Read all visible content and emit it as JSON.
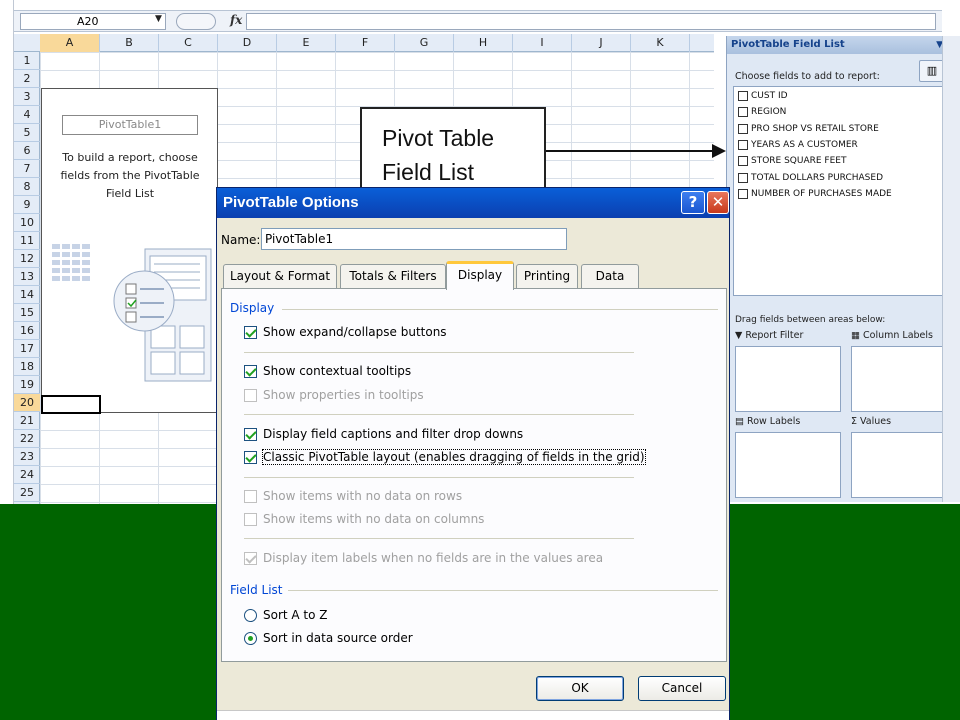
{
  "spreadsheet": {
    "name_box": "A20",
    "fx_label": "fx",
    "columns": [
      {
        "label": "A",
        "active": true
      },
      {
        "label": "B",
        "active": false
      },
      {
        "label": "C",
        "active": false
      },
      {
        "label": "D",
        "active": false
      },
      {
        "label": "E",
        "active": false
      },
      {
        "label": "F",
        "active": false
      },
      {
        "label": "G",
        "active": false
      },
      {
        "label": "H",
        "active": false
      },
      {
        "label": "I",
        "active": false
      },
      {
        "label": "J",
        "active": false
      },
      {
        "label": "K",
        "active": false
      }
    ],
    "rows": [
      "1",
      "2",
      "3",
      "4",
      "5",
      "6",
      "7",
      "8",
      "9",
      "10",
      "11",
      "12",
      "13",
      "14",
      "15",
      "16",
      "17",
      "18",
      "19",
      "20",
      "21",
      "22",
      "23",
      "24",
      "25"
    ],
    "active_row": "20"
  },
  "pivot_placeholder": {
    "name": "PivotTable1",
    "instruction_lines": [
      "To build a report, choose",
      "fields from the PivotTable",
      "Field List"
    ]
  },
  "callout": {
    "lines": [
      "Pivot Table",
      "Field List"
    ]
  },
  "field_list": {
    "title": "PivotTable Field List",
    "choose_label": "Choose fields to add to report:",
    "fields": [
      "CUST ID",
      "REGION",
      "PRO SHOP VS RETAIL STORE",
      "YEARS AS A CUSTOMER",
      "STORE SQUARE FEET",
      "TOTAL DOLLARS PURCHASED",
      "NUMBER OF PURCHASES MADE"
    ],
    "drag_label": "Drag fields between areas below:",
    "areas": {
      "report_filter": "Report Filter",
      "column_labels": "Column Labels",
      "row_labels": "Row Labels",
      "values": "Values"
    }
  },
  "dialog": {
    "title": "PivotTable Options",
    "help": "?",
    "close": "✕",
    "name_label": "Name:",
    "name_value": "PivotTable1",
    "tabs": [
      {
        "label": "Layout & Format",
        "selected": false
      },
      {
        "label": "Totals & Filters",
        "selected": false
      },
      {
        "label": "Display",
        "selected": true
      },
      {
        "label": "Printing",
        "selected": false
      },
      {
        "label": "Data",
        "selected": false
      }
    ],
    "display_section": "Display",
    "options": {
      "expand_collapse": {
        "label": "Show expand/collapse buttons",
        "checked": true,
        "enabled": true
      },
      "contextual_tooltips": {
        "label": "Show contextual tooltips",
        "checked": true,
        "enabled": true
      },
      "properties_tooltips": {
        "label": "Show properties in tooltips",
        "checked": false,
        "enabled": false
      },
      "field_captions": {
        "label": "Display field captions and filter drop downs",
        "checked": true,
        "enabled": true
      },
      "classic_layout": {
        "label": "Classic PivotTable layout (enables dragging of fields in the grid)",
        "checked": true,
        "enabled": true
      },
      "no_data_rows": {
        "label": "Show items with no data on rows",
        "checked": false,
        "enabled": false
      },
      "no_data_columns": {
        "label": "Show items with no data on columns",
        "checked": false,
        "enabled": false
      },
      "item_labels": {
        "label": "Display item labels when no fields are in the values area",
        "checked": true,
        "enabled": false
      }
    },
    "field_list_section": "Field List",
    "sort_options": {
      "a_to_z": {
        "label": "Sort A to Z",
        "selected": false
      },
      "data_source": {
        "label": "Sort in data source order",
        "selected": true
      }
    },
    "ok_label": "OK",
    "cancel_label": "Cancel"
  }
}
